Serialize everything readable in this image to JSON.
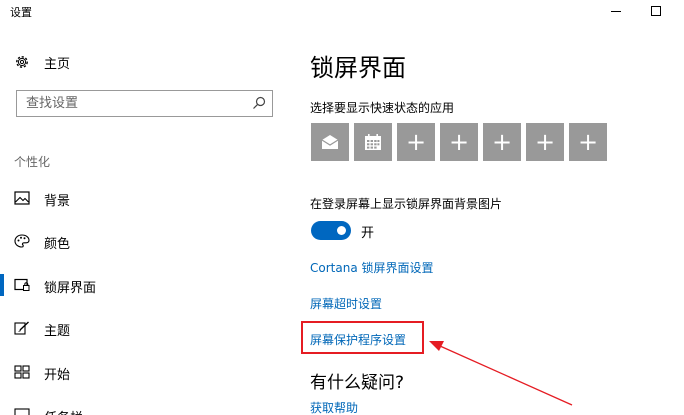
{
  "window": {
    "title": "设置"
  },
  "sidebar": {
    "home_label": "主页",
    "search_placeholder": "查找设置",
    "section_heading": "个性化",
    "items": [
      {
        "label": "背景",
        "icon": "picture-icon",
        "active": false
      },
      {
        "label": "颜色",
        "icon": "palette-icon",
        "active": false
      },
      {
        "label": "锁屏界面",
        "icon": "lock-screen-icon",
        "active": true
      },
      {
        "label": "主题",
        "icon": "theme-brush-icon",
        "active": false
      },
      {
        "label": "开始",
        "icon": "start-grid-icon",
        "active": false
      },
      {
        "label": "任务栏",
        "icon": "taskbar-icon",
        "active": false
      }
    ]
  },
  "main": {
    "title": "锁屏界面",
    "quick_status_label": "选择要显示快速状态的应用",
    "tiles": [
      {
        "icon": "mail-icon"
      },
      {
        "icon": "calendar-icon"
      },
      {
        "icon": "plus-icon",
        "glyph": "+"
      },
      {
        "icon": "plus-icon",
        "glyph": "+"
      },
      {
        "icon": "plus-icon",
        "glyph": "+"
      },
      {
        "icon": "plus-icon",
        "glyph": "+"
      },
      {
        "icon": "plus-icon",
        "glyph": "+"
      }
    ],
    "show_background_label": "在登录屏幕上显示锁屏界面背景图片",
    "toggle_state": "开",
    "links": {
      "cortana": "Cortana 锁屏界面设置",
      "timeout": "屏幕超时设置",
      "screensaver": "屏幕保护程序设置"
    },
    "help_title": "有什么疑问?",
    "help_link": "获取帮助"
  },
  "colors": {
    "accent": "#0067c0",
    "link": "#0067b8",
    "tile": "#999999",
    "annotation": "#e51c23"
  }
}
